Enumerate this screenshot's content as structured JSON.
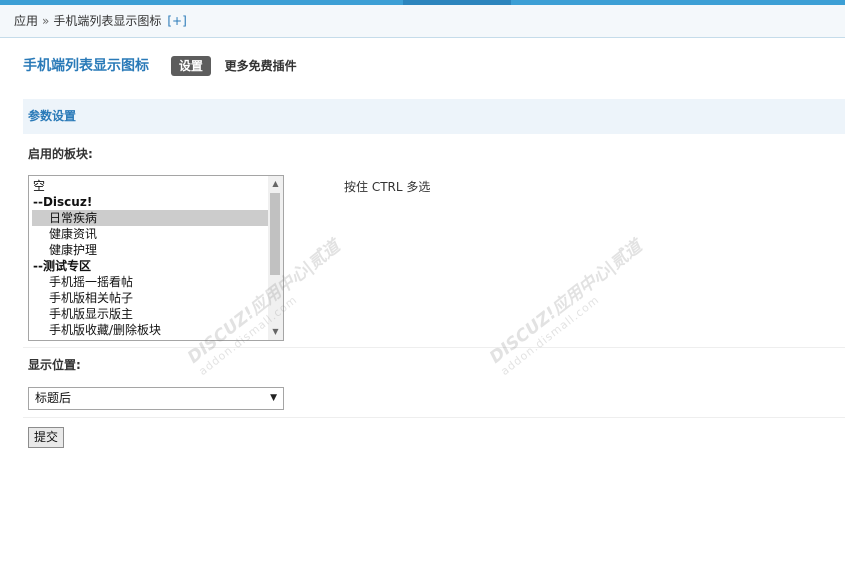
{
  "breadcrumb": {
    "root": "应用",
    "separator": "»",
    "current": "手机端列表显示图标",
    "expand": "[+]"
  },
  "plugin": {
    "title": "手机端列表显示图标",
    "tab_active": "设置",
    "tab_more": "更多免费插件"
  },
  "section": {
    "title": "参数设置"
  },
  "boards": {
    "label": "启用的板块:",
    "hint": "按住 CTRL 多选",
    "options": [
      {
        "text": "空",
        "kind": "item"
      },
      {
        "text": "--Discuz!",
        "kind": "group"
      },
      {
        "text": "日常疾病",
        "kind": "child",
        "selected": true
      },
      {
        "text": "健康资讯",
        "kind": "child"
      },
      {
        "text": "健康护理",
        "kind": "child"
      },
      {
        "text": "--测试专区",
        "kind": "group"
      },
      {
        "text": "手机摇一摇看帖",
        "kind": "child"
      },
      {
        "text": "手机版相关帖子",
        "kind": "child"
      },
      {
        "text": "手机版显示版主",
        "kind": "child"
      },
      {
        "text": "手机版收藏/删除板块",
        "kind": "child"
      }
    ]
  },
  "position": {
    "label": "显示位置:",
    "selected": "标题后"
  },
  "submit": {
    "label": "提交"
  },
  "watermark": {
    "main": "DISCUZ!应用中心|贰道",
    "sub": "addon.dismall.com"
  },
  "colors": {
    "accent": "#2a7ab8",
    "top_bar": "#3c9fd5",
    "section_bg": "#edf4fa"
  }
}
